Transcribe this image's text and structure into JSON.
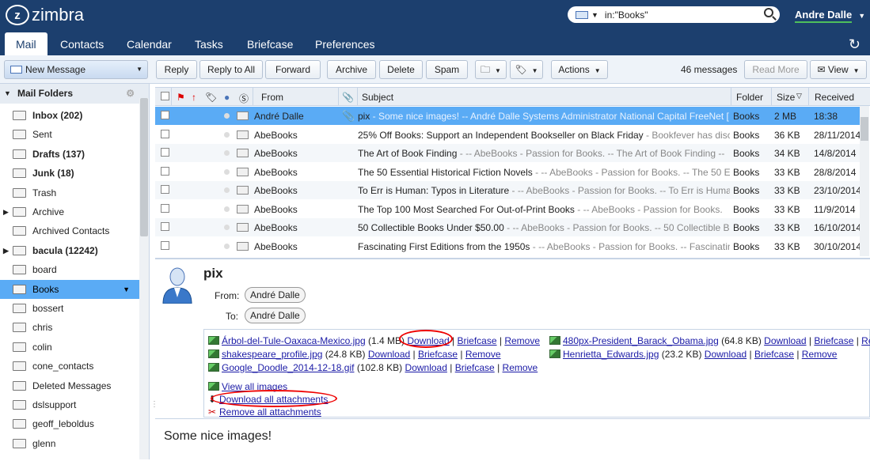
{
  "app": {
    "logo": "zimbra"
  },
  "search": {
    "value": "in:\"Books\""
  },
  "user": {
    "name": "Andre Dalle"
  },
  "tabs": [
    "Mail",
    "Contacts",
    "Calendar",
    "Tasks",
    "Briefcase",
    "Preferences"
  ],
  "toolbar": {
    "new_message": "New Message",
    "reply": "Reply",
    "reply_all": "Reply to All",
    "forward": "Forward",
    "archive": "Archive",
    "delete": "Delete",
    "spam": "Spam",
    "actions": "Actions",
    "count": "46 messages",
    "read_more": "Read More",
    "view": "View"
  },
  "sidebar": {
    "header": "Mail Folders",
    "folders": [
      {
        "label": "Inbox (202)",
        "bold": true
      },
      {
        "label": "Sent"
      },
      {
        "label": "Drafts (137)",
        "bold": true
      },
      {
        "label": "Junk (18)",
        "bold": true
      },
      {
        "label": "Trash"
      },
      {
        "label": "Archive",
        "expand": true
      },
      {
        "label": "Archived Contacts"
      },
      {
        "label": "bacula (12242)",
        "bold": true,
        "expand": true
      },
      {
        "label": "board"
      },
      {
        "label": "Books",
        "selected": true
      },
      {
        "label": "bossert"
      },
      {
        "label": "chris"
      },
      {
        "label": "colin"
      },
      {
        "label": "cone_contacts"
      },
      {
        "label": "Deleted Messages"
      },
      {
        "label": "dslsupport"
      },
      {
        "label": "geoff_leboldus"
      },
      {
        "label": "glenn"
      }
    ]
  },
  "list": {
    "headers": {
      "from": "From",
      "subject": "Subject",
      "folder": "Folder",
      "size": "Size",
      "received": "Received"
    },
    "rows": [
      {
        "from": "André Dalle",
        "subject": "pix",
        "fragment": " - Some nice images! -- André Dalle Systems Administrator National Capital FreeNet [",
        "folder": "Books",
        "size": "2 MB",
        "received": "18:38",
        "selected": true,
        "attach": true
      },
      {
        "from": "AbeBooks",
        "subject": "25% Off Books: Support an Independent Bookseller on Black Friday",
        "fragment": " - Bookfever has disc",
        "folder": "Books",
        "size": "36 KB",
        "received": "28/11/2014"
      },
      {
        "from": "AbeBooks",
        "subject": "The Art of Book Finding",
        "fragment": " - -- AbeBooks - Passion for Books. -- The Art of Book Finding -- ",
        "folder": "Books",
        "size": "34 KB",
        "received": "14/8/2014"
      },
      {
        "from": "AbeBooks",
        "subject": "The 50 Essential Historical Fiction Novels",
        "fragment": " - -- AbeBooks - Passion for Books. -- The 50 E",
        "folder": "Books",
        "size": "33 KB",
        "received": "28/8/2014"
      },
      {
        "from": "AbeBooks",
        "subject": "To Err is Human: Typos in Literature",
        "fragment": " - -- AbeBooks - Passion for Books. -- To Err is Huma",
        "folder": "Books",
        "size": "33 KB",
        "received": "23/10/2014"
      },
      {
        "from": "AbeBooks",
        "subject": "The Top 100 Most Searched For Out-of-Print Books",
        "fragment": " - -- AbeBooks - Passion for Books. ",
        "folder": "Books",
        "size": "33 KB",
        "received": "11/9/2014"
      },
      {
        "from": "AbeBooks",
        "subject": "50 Collectible Books Under $50.00",
        "fragment": " - -- AbeBooks - Passion for Books. -- 50 Collectible B",
        "folder": "Books",
        "size": "33 KB",
        "received": "16/10/2014"
      },
      {
        "from": "AbeBooks",
        "subject": "Fascinating First Editions from the 1950s",
        "fragment": " - -- AbeBooks - Passion for Books. -- Fascinatin",
        "folder": "Books",
        "size": "33 KB",
        "received": "30/10/2014"
      }
    ]
  },
  "reading": {
    "title": "pix",
    "from_label": "From:",
    "from": "André Dalle",
    "to_label": "To:",
    "to": "André Dalle",
    "attachments": [
      {
        "name": "Árbol-del-Tule-Oaxaca-Mexico.jpg",
        "size": "(1.4 MB)"
      },
      {
        "name": "shakespeare_profile.jpg",
        "size": "(24.8 KB)"
      },
      {
        "name": "Google_Doodle_2014-12-18.gif",
        "size": "(102.8 KB)"
      },
      {
        "name": "480px-President_Barack_Obama.jpg",
        "size": "(64.8 KB)"
      },
      {
        "name": "Henrietta_Edwards.jpg",
        "size": "(23.2 KB)"
      }
    ],
    "download": "Download",
    "briefcase": "Briefcase",
    "remove": "Remove",
    "remove_partial": "Re",
    "view_all": "View all images",
    "download_all": "Download all attachments",
    "remove_all": "Remove all attachments",
    "body": "Some nice images!"
  }
}
